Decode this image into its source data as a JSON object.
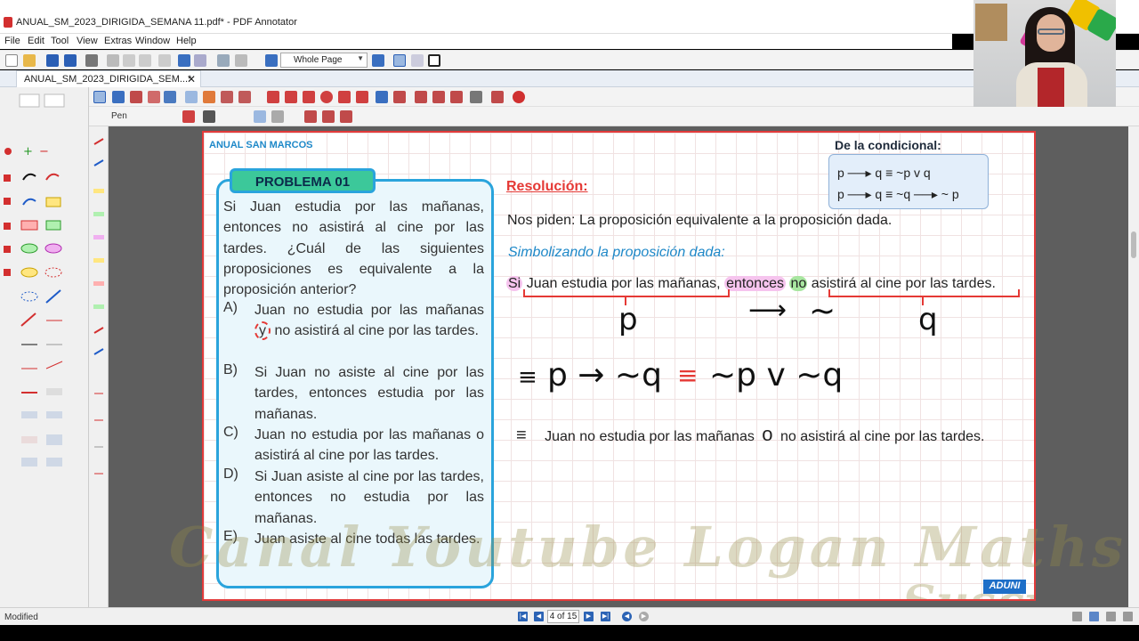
{
  "window": {
    "title": "ANUAL_SM_2023_DIRIGIDA_SEMANA 11.pdf* - PDF Annotator"
  },
  "menu": [
    "File",
    "Edit",
    "Tool",
    "View",
    "Extras",
    "Window",
    "Help"
  ],
  "toolbar": {
    "zoom_mode": "Whole Page",
    "pen_label": "Pen"
  },
  "tab": {
    "label": "ANUAL_SM_2023_DIRIGIDA_SEM...*",
    "close": "✕"
  },
  "page": {
    "series_label": "ANUAL SAN MARCOS",
    "problem": {
      "badge": "PROBLEMA  01",
      "statement": "Si Juan estudia por las mañanas, entonces no asistirá al cine por las tardes. ¿Cuál de las siguientes proposiciones es equivalente a la proposición anterior?",
      "options": [
        {
          "letter": "A)",
          "before": "Juan no estudia por las mañanas",
          "circled": "y",
          "after": " no asistirá al cine por las tardes."
        },
        {
          "letter": "B)",
          "text": "Si Juan no asiste al cine por las tardes, entonces estudia por las mañanas."
        },
        {
          "letter": "C)",
          "text": "Juan no estudia por las mañanas o asistirá al cine por las tardes."
        },
        {
          "letter": "D)",
          "text": "Si Juan asiste al cine por las tardes, entonces no estudia por las mañanas."
        },
        {
          "letter": "E)",
          "text": "Juan asiste al cine todas las tardes."
        }
      ]
    },
    "conditional": {
      "title": "De la condicional:",
      "line1": "p ──▸ q  ≡ ~p v q",
      "line2": "p ──▸ q  ≡ ~q ──▸ ~ p"
    },
    "resolution": {
      "heading": "Resolución:",
      "piden": "Nos piden: La proposición equivalente a la proposición dada.",
      "simbolizando": "Simbolizando la proposición dada:",
      "prop": {
        "si": "Si",
        "p_text": "Juan estudia por las mañanas,",
        "entonces": "entonces",
        "no": "no",
        "q_text": "asistirá al cine por las tardes."
      },
      "handwriting": {
        "p": "p",
        "arrow": "⟶",
        "tilde": "~",
        "q": "q"
      },
      "formula": {
        "eq1": "≡",
        "lhs": "p → ~q",
        "eq2": "≡",
        "rhs": "~p v ~q"
      },
      "equivalent": {
        "sym": "≡",
        "part1": "Juan no estudia por las mañanas",
        "o": "o",
        "part2": "no asistirá al cine por las tardes."
      }
    },
    "watermark": {
      "line1": "Suscríbete a:",
      "line2": "Canal Youtube Logan Maths"
    },
    "logo": "ADUNI"
  },
  "status": {
    "text": "Modified",
    "page_indicator": "4 of 15"
  },
  "colors": {
    "accent_red": "#e53935",
    "accent_blue": "#2aa4dc",
    "badge_green": "#3cc89a"
  }
}
